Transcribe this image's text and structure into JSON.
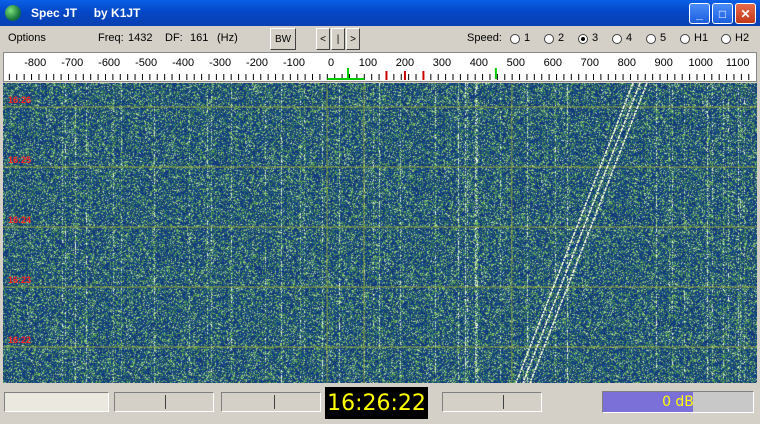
{
  "window": {
    "title": "Spec JT     by K1JT",
    "buttons": {
      "minimize": "_",
      "maximize": "□",
      "close": "✕"
    }
  },
  "toolbar": {
    "options_label": "Options",
    "freq_label": "Freq:",
    "freq_value": "1432",
    "df_label": "DF:",
    "df_value": "161",
    "df_unit": "(Hz)",
    "bw_button": "BW",
    "nav_left": "<",
    "nav_center": "|",
    "nav_right": ">",
    "speed_label": "Speed:",
    "speed_options": [
      "1",
      "2",
      "3",
      "4",
      "5",
      "H1",
      "H2"
    ],
    "speed_selected": "3"
  },
  "scale": {
    "tick_labels": [
      "-800",
      "-700",
      "-600",
      "-500",
      "-400",
      "-300",
      "-200",
      "-100",
      "0",
      "100",
      "200",
      "300",
      "400",
      "500",
      "600",
      "700",
      "800",
      "900",
      "1000",
      "1100"
    ],
    "green_markers": [
      0,
      400
    ],
    "red_markers": [
      150,
      200,
      250
    ],
    "colors": {
      "green": "#00cc00",
      "red": "#cc0000"
    }
  },
  "waterfall": {
    "time_labels": [
      "16:26",
      "16:25",
      "16:24",
      "16:23",
      "16:22"
    ],
    "colors": {
      "background": "#1d3f86",
      "grid": "#9aa838",
      "label": "#ff2020",
      "trace": "#fffde0"
    }
  },
  "statusbar": {
    "clock": "16:26:22",
    "level": "0 dB",
    "level_fraction": 0.6
  }
}
